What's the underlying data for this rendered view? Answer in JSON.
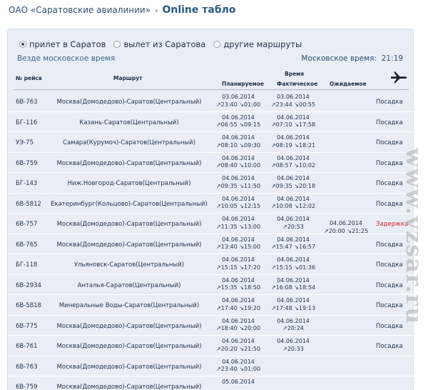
{
  "breadcrumb": {
    "parent": "ОАО «Саратовские авиалинии»",
    "separator": "›",
    "title": "Online табло"
  },
  "filters": {
    "options": [
      {
        "label": "прилет в Саратов",
        "selected": true
      },
      {
        "label": "вылет из Саратова",
        "selected": false
      },
      {
        "label": "другие маршруты",
        "selected": false
      }
    ]
  },
  "tz_note": "Везде московское время",
  "moscow_time": {
    "label": "Московское время:",
    "value": "21:19"
  },
  "table": {
    "columns": {
      "flight": "№ рейса",
      "route": "Маршрут",
      "time_group": "Время",
      "planned": "Планируемое",
      "actual": "Фактическое",
      "expected": "Ожидаемое",
      "status_icon": "plane-icon"
    },
    "rows": [
      {
        "flight": "6В-763",
        "route": "Москва(Домодедово)-Саратов(Центральный)",
        "planned": {
          "date": "03.06.2014",
          "times": "↗23:40  ↘01:00"
        },
        "actual": {
          "date": "03.06.2014",
          "times": "↗23:44  ↘00:55"
        },
        "expected": {
          "date": "",
          "times": ""
        },
        "status": "Посадка",
        "delay": false
      },
      {
        "flight": "БГ-116",
        "route": "Казань-Саратов(Центральный)",
        "planned": {
          "date": "04.06.2014",
          "times": "↗06:55  ↘09:15"
        },
        "actual": {
          "date": "04.06.2014",
          "times": "↗07:10  ↘17:58"
        },
        "expected": {
          "date": "",
          "times": ""
        },
        "status": "Посадка",
        "delay": false
      },
      {
        "flight": "УЭ-75",
        "route": "Самара(Курумоч)-Саратов(Центральный)",
        "planned": {
          "date": "04.06.2014",
          "times": "↗08:10  ↘09:30"
        },
        "actual": {
          "date": "04.06.2014",
          "times": "↗08:19  ↘18:21"
        },
        "expected": {
          "date": "",
          "times": ""
        },
        "status": "Посадка",
        "delay": false
      },
      {
        "flight": "6В-759",
        "route": "Москва(Домодедово)-Саратов(Центральный)",
        "planned": {
          "date": "04.06.2014",
          "times": "↗08:40  ↘10:00"
        },
        "actual": {
          "date": "04.06.2014",
          "times": "↗08:57  ↘10:02"
        },
        "expected": {
          "date": "",
          "times": ""
        },
        "status": "Посадка",
        "delay": false
      },
      {
        "flight": "БГ-143",
        "route": "Ниж.Новгород-Саратов(Центральный)",
        "planned": {
          "date": "04.06.2014",
          "times": "↗09:35  ↘11:50"
        },
        "actual": {
          "date": "04.06.2014",
          "times": "↗09:35  ↘20:18"
        },
        "expected": {
          "date": "",
          "times": ""
        },
        "status": "Посадка",
        "delay": false
      },
      {
        "flight": "6В-5812",
        "route": "Екатеринбург(Кольцово)-Саратов(Центральный)",
        "planned": {
          "date": "04.06.2014",
          "times": "↗10:05  ↘12:15"
        },
        "actual": {
          "date": "04.06.2014",
          "times": "↗10:08  ↘12:02"
        },
        "expected": {
          "date": "",
          "times": ""
        },
        "status": "Посадка",
        "delay": false
      },
      {
        "flight": "6В-757",
        "route": "Москва(Домодедово)-Саратов(Центральный)",
        "planned": {
          "date": "04.06.2014",
          "times": "↗11:35  ↘13:00"
        },
        "actual": {
          "date": "04.06.2014",
          "times": "↗20:53"
        },
        "expected": {
          "date": "04.06.2014",
          "times": "↗20:00  ↘21:25"
        },
        "status": "Задержка",
        "delay": true
      },
      {
        "flight": "6В-765",
        "route": "Москва(Домодедово)-Саратов(Центральный)",
        "planned": {
          "date": "04.06.2014",
          "times": "↗13:40  ↘15:00"
        },
        "actual": {
          "date": "04.06.2014",
          "times": "↗15:47  ↘16:57"
        },
        "expected": {
          "date": "",
          "times": ""
        },
        "status": "Посадка",
        "delay": false
      },
      {
        "flight": "БГ-118",
        "route": "Ульяновск-Саратов(Центральный)",
        "planned": {
          "date": "04.06.2014",
          "times": "↗15:15  ↘17:20"
        },
        "actual": {
          "date": "04.06.2014",
          "times": "↗15:15  ↘01:36"
        },
        "expected": {
          "date": "",
          "times": ""
        },
        "status": "Посадка",
        "delay": false
      },
      {
        "flight": "6В-2934",
        "route": "Анталья-Саратов(Центральный)",
        "planned": {
          "date": "04.06.2014",
          "times": "↗15:35  ↘18:50"
        },
        "actual": {
          "date": "04.06.2014",
          "times": "↗16:08  ↘18:54"
        },
        "expected": {
          "date": "",
          "times": ""
        },
        "status": "Посадка",
        "delay": false
      },
      {
        "flight": "6В-5818",
        "route": "Минеральные Воды-Саратов(Центральный)",
        "planned": {
          "date": "04.06.2014",
          "times": "↗17:40  ↘19:20"
        },
        "actual": {
          "date": "04.06.2014",
          "times": "↗17:48  ↘19:13"
        },
        "expected": {
          "date": "",
          "times": ""
        },
        "status": "Посадка",
        "delay": false
      },
      {
        "flight": "6В-775",
        "route": "Москва(Домодедово)-Саратов(Центральный)",
        "planned": {
          "date": "04.06.2014",
          "times": "↗18:40  ↘20:00"
        },
        "actual": {
          "date": "04.06.2014",
          "times": "↗20:24"
        },
        "expected": {
          "date": "",
          "times": ""
        },
        "status": "Посадка",
        "delay": false
      },
      {
        "flight": "6В-761",
        "route": "Москва(Домодедово)-Саратов(Центральный)",
        "planned": {
          "date": "04.06.2014",
          "times": "↗20:20  ↘21:50"
        },
        "actual": {
          "date": "04.06.2014",
          "times": "↗20:33"
        },
        "expected": {
          "date": "",
          "times": ""
        },
        "status": "Посадка",
        "delay": false
      },
      {
        "flight": "6В-763",
        "route": "Москва(Домодедово)-Саратов(Центральный)",
        "planned": {
          "date": "04.06.2014",
          "times": "↗23:40  ↘01:00"
        },
        "actual": {
          "date": "",
          "times": ""
        },
        "expected": {
          "date": "",
          "times": ""
        },
        "status": "",
        "delay": false
      },
      {
        "flight": "6В-759",
        "route": "Москва(Домодедово)-Саратов(Центральный)",
        "planned": {
          "date": "05.06.2014",
          "times": ""
        },
        "actual": {
          "date": "",
          "times": ""
        },
        "expected": {
          "date": "",
          "times": ""
        },
        "status": "",
        "delay": false
      }
    ]
  },
  "watermark": "www.vzsar.ru",
  "colors": {
    "delay": "#d21f1f",
    "panel": "#e9eef6",
    "title": "#2a5a88"
  }
}
